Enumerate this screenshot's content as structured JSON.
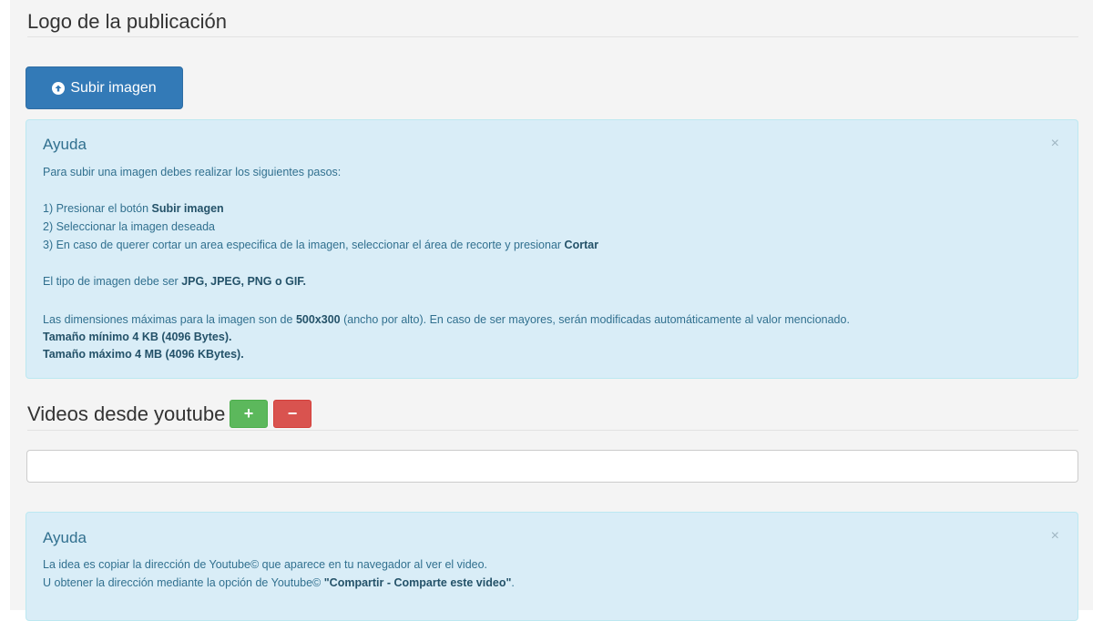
{
  "logo_section": {
    "title": "Logo de la publicación",
    "upload_button_label": "Subir imagen"
  },
  "logo_help": {
    "close_glyph": "×",
    "title": "Ayuda",
    "intro": "Para subir una imagen debes realizar los siguientes pasos:",
    "step1_text": "1) Presionar el botón ",
    "step1_bold": "Subir imagen",
    "step2_text": "2) Seleccionar la imagen deseada",
    "step3_text": "3) En caso de querer cortar un area especifica de la imagen, seleccionar el área de recorte y presionar ",
    "step3_bold": "Cortar",
    "type_text": "El tipo de imagen debe ser ",
    "type_bold": "JPG, JPEG, PNG o GIF.",
    "dims_text1": "Las dimensiones máximas para la imagen son de ",
    "dims_bold": "500x300",
    "dims_text2": " (ancho por alto). En caso de ser mayores, serán modificadas automáticamente al valor mencionado.",
    "min_size": "Tamaño mínimo 4 KB (4096 Bytes).",
    "max_size": "Tamaño máximo 4 MB (4096 KBytes)."
  },
  "videos_section": {
    "title": "Videos desde youtube",
    "add_label": "+",
    "remove_label": "−",
    "url_value": ""
  },
  "video_help": {
    "close_glyph": "×",
    "title": "Ayuda",
    "line1": "La idea es copiar la dirección de Youtube© que aparece en tu navegador al ver el video.",
    "line2_text": "U obtener la dirección mediante la opción de Youtube© ",
    "line2_bold": "\"Compartir - Comparte este video\"",
    "line2_end": "."
  },
  "colors": {
    "primary": "#337ab7",
    "success": "#5cb85c",
    "danger": "#d9534f",
    "info_bg": "#d9edf7",
    "info_text": "#31708f"
  }
}
